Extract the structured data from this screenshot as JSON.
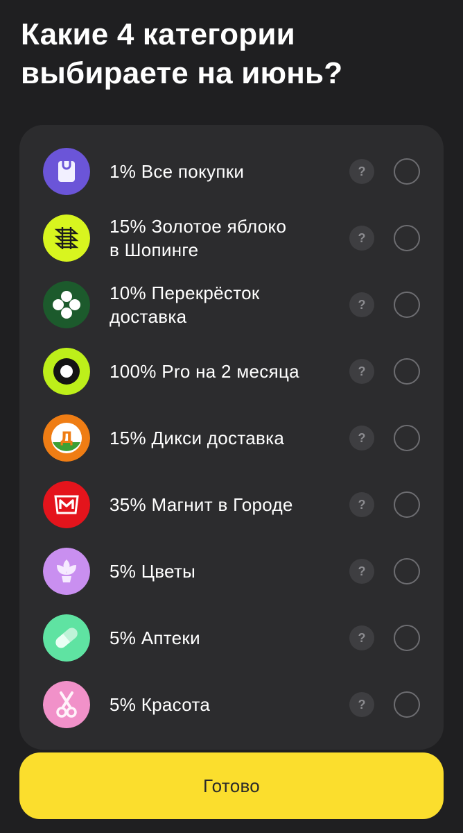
{
  "header": {
    "title": "Какие 4 категории выбираете на июнь?"
  },
  "categories": [
    {
      "label_line1": "1% Все покупки",
      "label_line2": "",
      "icon": "shopping-bag-icon",
      "color": "#6b55d8",
      "help": "?"
    },
    {
      "label_line1": "15% Золотое яблоко",
      "label_line2": "в Шопинге",
      "icon": "golden-apple-logo-icon",
      "color": "#d8f51f",
      "help": "?"
    },
    {
      "label_line1": "10% Перекрёсток",
      "label_line2": "доставка",
      "icon": "perekrestok-logo-icon",
      "color": "#1c5a2c",
      "help": "?"
    },
    {
      "label_line1": "100% Pro на 2 месяца",
      "label_line2": "",
      "icon": "pro-ring-icon",
      "color": "#bdef1a",
      "help": "?"
    },
    {
      "label_line1": "15% Дикси доставка",
      "label_line2": "",
      "icon": "dixy-logo-icon",
      "color": "#ef7d14",
      "help": "?"
    },
    {
      "label_line1": "35% Магнит в Городе",
      "label_line2": "",
      "icon": "magnit-logo-icon",
      "color": "#e4141c",
      "help": "?"
    },
    {
      "label_line1": "5% Цветы",
      "label_line2": "",
      "icon": "flower-icon",
      "color": "#c98ff0",
      "help": "?"
    },
    {
      "label_line1": "5% Аптеки",
      "label_line2": "",
      "icon": "pill-icon",
      "color": "#5fe3a2",
      "help": "?"
    },
    {
      "label_line1": "5% Красота",
      "label_line2": "",
      "icon": "scissors-icon",
      "color": "#f191c9",
      "help": "?"
    }
  ],
  "footer": {
    "done_label": "Готово"
  }
}
